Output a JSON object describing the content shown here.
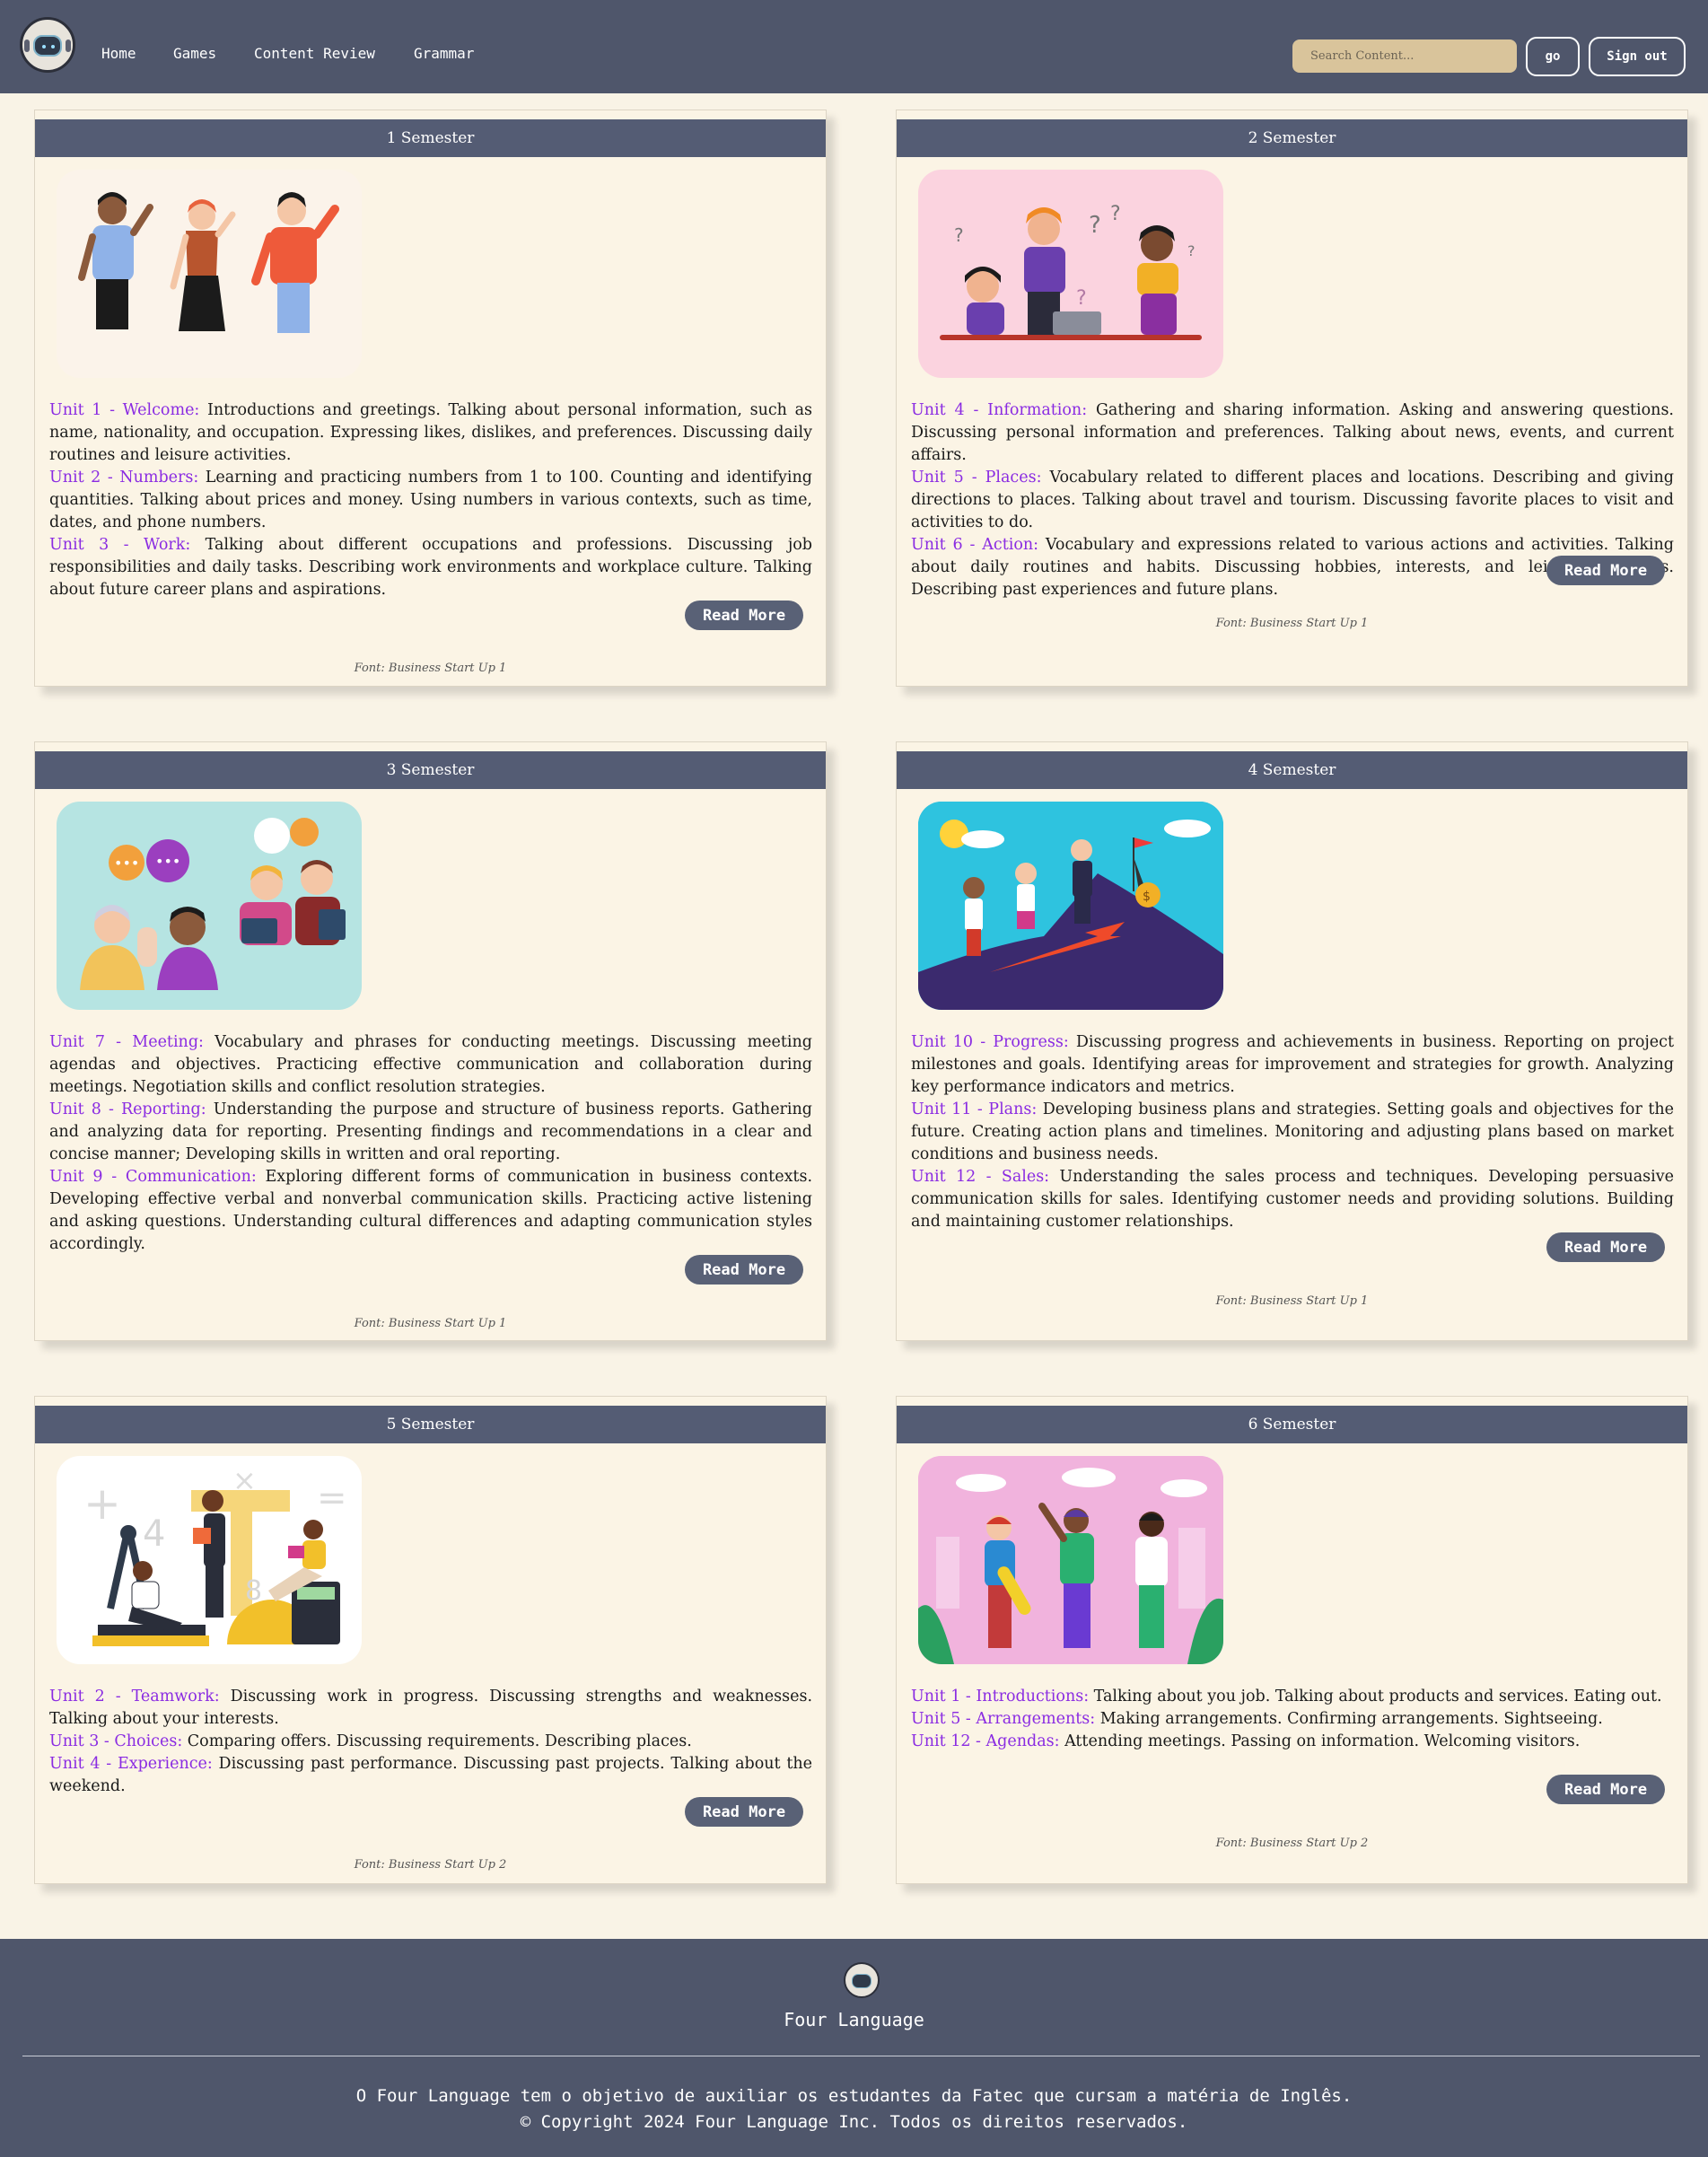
{
  "nav": {
    "links": [
      "Home",
      "Games",
      "Content Review",
      "Grammar"
    ],
    "search_placeholder": "Search Content...",
    "go_label": "go",
    "signout_label": "Sign out"
  },
  "read_more_label": "Read More",
  "semesters": [
    {
      "title": "1 Semester",
      "illustration": "three-people-waving",
      "units": [
        {
          "title": "Unit 1 - Welcome:",
          "text": " Introductions and greetings. Talking about personal information, such as name, nationality, and occupation. Expressing likes, dislikes, and preferences. Discussing daily routines and leisure activities."
        },
        {
          "title": "Unit 2 - Numbers:",
          "text": " Learning and practicing numbers from 1 to 100. Counting and identifying quantities. Talking about prices and money. Using numbers in various contexts, such as time, dates, and phone numbers."
        },
        {
          "title": "Unit 3 - Work:",
          "text": " Talking about different occupations and professions. Discussing job responsibilities and daily tasks. Describing work environments and workplace culture. Talking about future career plans and aspirations."
        }
      ],
      "source": "Font: Business Start Up 1"
    },
    {
      "title": "2 Semester",
      "illustration": "people-asking-questions",
      "units": [
        {
          "title": "Unit 4 - Information:",
          "text": " Gathering and sharing information. Asking and answering questions. Discussing personal information and preferences. Talking about news, events, and current affairs."
        },
        {
          "title": "Unit 5 - Places:",
          "text": " Vocabulary related to different places and locations. Describing and giving directions to places. Talking about travel and tourism. Discussing favorite places to visit and activities to do."
        },
        {
          "title": "Unit 6 - Action:",
          "text": " Vocabulary and expressions related to various actions and activities. Talking about daily routines and habits. Discussing hobbies, interests, and leisure activities. Describing past experiences and future plans."
        }
      ],
      "source": "Font: Business Start Up 1"
    },
    {
      "title": "3 Semester",
      "illustration": "people-talking-podcast",
      "units": [
        {
          "title": "Unit 7 - Meeting:",
          "text": " Vocabulary and phrases for conducting meetings. Discussing meeting agendas and objectives. Practicing effective communication and collaboration during meetings. Negotiation skills and conflict resolution strategies."
        },
        {
          "title": "Unit 8 - Reporting:",
          "text": " Understanding the purpose and structure of business reports. Gathering and analyzing data for reporting. Presenting findings and recommendations in a clear and concise manner; Developing skills in written and oral reporting."
        },
        {
          "title": "Unit 9 - Communication:",
          "text": " Exploring different forms of communication in business contexts. Developing effective verbal and nonverbal communication skills. Practicing active listening and asking questions. Understanding cultural differences and adapting communication styles accordingly."
        }
      ],
      "source": "Font: Business Start Up 1"
    },
    {
      "title": "4 Semester",
      "illustration": "team-climbing-mountain",
      "units": [
        {
          "title": "Unit 10 - Progress:",
          "text": " Discussing progress and achievements in business. Reporting on project milestones and goals. Identifying areas for improvement and strategies for growth. Analyzing key performance indicators and metrics."
        },
        {
          "title": "Unit 11 - Plans:",
          "text": " Developing business plans and strategies. Setting goals and objectives for the future. Creating action plans and timelines. Monitoring and adjusting plans based on market conditions and business needs."
        },
        {
          "title": "Unit 12 - Sales:",
          "text": " Understanding the sales process and techniques. Developing persuasive communication skills for sales. Identifying customer needs and providing solutions. Building and maintaining customer relationships."
        }
      ],
      "source": "Font: Business Start Up 1"
    },
    {
      "title": "5 Semester",
      "illustration": "students-studying-math",
      "units": [
        {
          "title": "Unit 2 - Teamwork:",
          "text": " Discussing work in progress. Discussing strengths and weaknesses. Talking about your interests."
        },
        {
          "title": "Unit 3 - Choices:",
          "text": " Comparing offers. Discussing requirements. Describing places."
        },
        {
          "title": "Unit 4 - Experience:",
          "text": " Discussing past performance. Discussing past projects. Talking about the weekend."
        }
      ],
      "source": "Font: Business Start Up 2"
    },
    {
      "title": "6 Semester",
      "illustration": "friends-high-five",
      "units": [
        {
          "title": "Unit 1 - Introductions:",
          "text": " Talking about you job. Talking about products and services. Eating out."
        },
        {
          "title": "Unit 5 - Arrangements:",
          "text": " Making arrangements. Confirming arrangements. Sightseeing."
        },
        {
          "title": "Unit 12 - Agendas:",
          "text": " Attending meetings. Passing on information. Welcoming visitors."
        }
      ],
      "source": "Font: Business Start Up 2"
    }
  ],
  "footer": {
    "brand": "Four Language",
    "description": "O Four Language tem o objetivo de auxiliar os estudantes da Fatec que cursam a matéria de Inglês.",
    "copyright": "© Copyright 2024 Four Language Inc. Todos os direitos reservados."
  },
  "colors": {
    "navbar": "#4f566b",
    "background": "#f9f3e6",
    "unit_title": "#8a2be2",
    "search_bg": "#d9c49b"
  }
}
